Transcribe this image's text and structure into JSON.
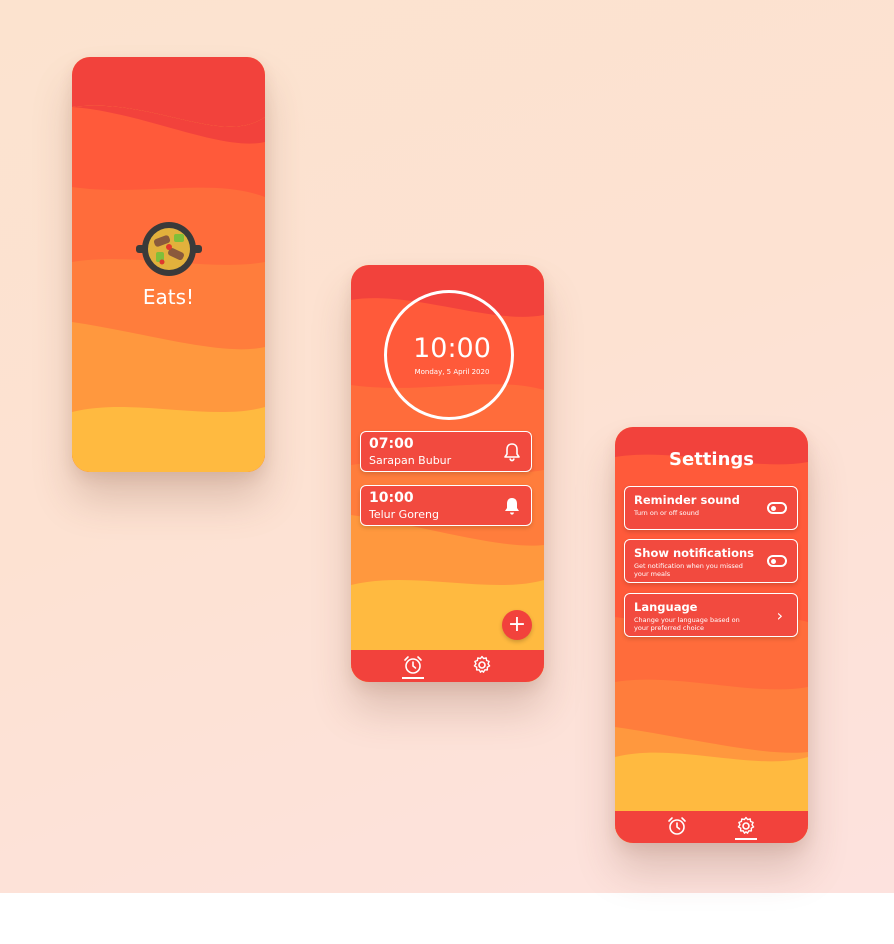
{
  "colors": {
    "red": "#f2423c",
    "orange_red": "#ff5e3a",
    "orange": "#ff7b3b",
    "light_orange": "#ff9a3d",
    "yellow": "#ffba40"
  },
  "splash": {
    "app_name": "Eats!",
    "logo_icon": "paella-pan-icon"
  },
  "alarms_screen": {
    "clock": {
      "time": "10:00",
      "date": "Monday, 5 April 2020"
    },
    "alarms": [
      {
        "time": "07:00",
        "name": "Sarapan Bubur",
        "bell": "bell-outline-icon"
      },
      {
        "time": "10:00",
        "name": "Telur Goreng",
        "bell": "bell-filled-icon"
      }
    ],
    "add_button": "+",
    "tabs": [
      {
        "icon": "alarm-clock-icon",
        "active": true
      },
      {
        "icon": "gear-icon",
        "active": false
      }
    ]
  },
  "settings_screen": {
    "title": "Settings",
    "items": [
      {
        "title": "Reminder sound",
        "desc": "Turn on or off sound",
        "control": "toggle"
      },
      {
        "title": "Show notifications",
        "desc": "Get notification when you missed your meals",
        "control": "toggle"
      },
      {
        "title": "Language",
        "desc": "Change your language based on your preferred choice",
        "control": "chevron",
        "chevron": "›"
      }
    ],
    "tabs": [
      {
        "icon": "alarm-clock-icon",
        "active": false
      },
      {
        "icon": "gear-icon",
        "active": true
      }
    ]
  }
}
